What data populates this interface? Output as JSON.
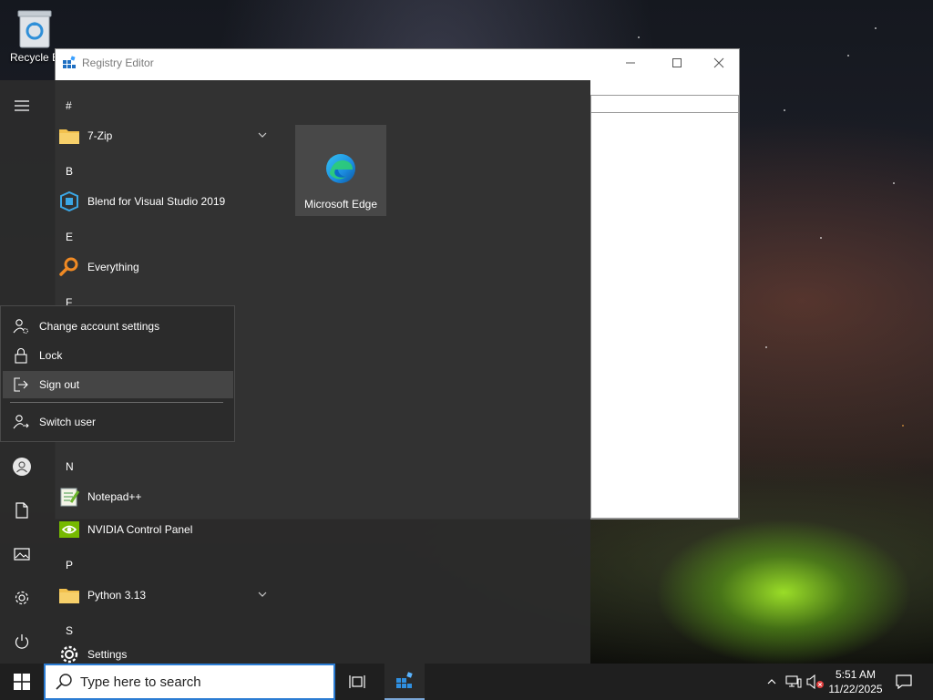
{
  "desktop": {
    "recycle_bin_label": "Recycle B"
  },
  "registry_window": {
    "title": "Registry Editor",
    "controls": [
      "minimize-icon",
      "maximize-icon",
      "close-icon"
    ]
  },
  "start_menu": {
    "rail": [
      "hamburger-icon",
      "user-avatar-icon",
      "documents-icon",
      "pictures-icon",
      "settings-icon",
      "power-icon"
    ],
    "letters": {
      "hash": "#",
      "b": "B",
      "e": "E",
      "f": "F",
      "n": "N",
      "p": "P",
      "s": "S"
    },
    "apps": {
      "seven_zip": "7-Zip",
      "blend": "Blend for Visual Studio 2019",
      "everything": "Everything",
      "notepad": "Notepad++",
      "nvidia": "NVIDIA Control Panel",
      "python": "Python 3.13",
      "settings": "Settings"
    },
    "tile": {
      "label": "Microsoft Edge"
    }
  },
  "account_flyout": {
    "change_account": "Change account settings",
    "lock": "Lock",
    "sign_out": "Sign out",
    "switch_user": "Switch user"
  },
  "taskbar": {
    "search_placeholder": "Type here to search",
    "time": "5:51 AM",
    "date": "11/22/2025",
    "accent_color": "#2b7cd3"
  }
}
